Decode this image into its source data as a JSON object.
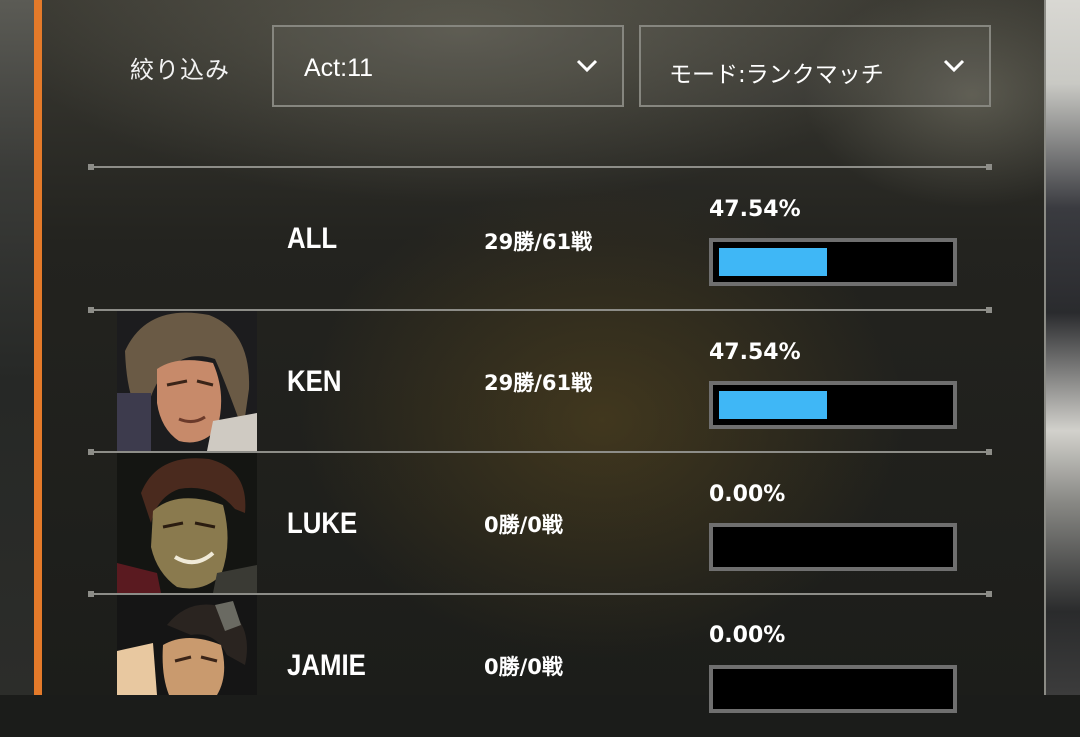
{
  "filter": {
    "label": "絞り込み",
    "act_select": {
      "value": "Act:11"
    },
    "mode_select": {
      "value": "モード:ランクマッチ"
    }
  },
  "colors": {
    "accent_orange": "#e47a2a",
    "bar_fill": "#3fb7f6",
    "bar_border": "#6f6f6f"
  },
  "rows": [
    {
      "name": "ALL",
      "record": "29勝/61戦",
      "rate": "47.54%",
      "rate_value": 47.54,
      "portrait": null
    },
    {
      "name": "KEN",
      "record": "29勝/61戦",
      "rate": "47.54%",
      "rate_value": 47.54,
      "portrait": "ken-portrait"
    },
    {
      "name": "LUKE",
      "record": "0勝/0戦",
      "rate": "0.00%",
      "rate_value": 0,
      "portrait": "luke-portrait"
    },
    {
      "name": "JAMIE",
      "record": "0勝/0戦",
      "rate": "0.00%",
      "rate_value": 0,
      "portrait": "jamie-portrait"
    }
  ]
}
